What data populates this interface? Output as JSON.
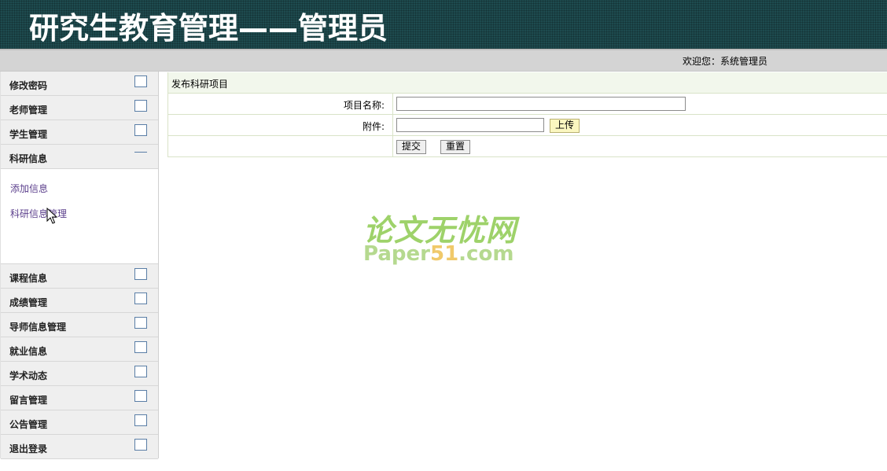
{
  "header": {
    "title": "研究生教育管理——管理员"
  },
  "welcome": {
    "text": "欢迎您：系统管理员"
  },
  "sidebar": {
    "items_top": [
      {
        "label": "修改密码"
      },
      {
        "label": "老师管理"
      },
      {
        "label": "学生管理"
      }
    ],
    "open_item": {
      "label": "科研信息",
      "sublinks": [
        {
          "label": "添加信息"
        },
        {
          "label": "科研信息管理"
        }
      ]
    },
    "items_bottom": [
      {
        "label": "课程信息"
      },
      {
        "label": "成绩管理"
      },
      {
        "label": "导师信息管理"
      },
      {
        "label": "就业信息"
      },
      {
        "label": "学术动态"
      },
      {
        "label": "留言管理"
      },
      {
        "label": "公告管理"
      },
      {
        "label": "退出登录"
      }
    ]
  },
  "form": {
    "title": "发布科研项目",
    "project_name_label": "项目名称:",
    "project_name_value": "",
    "attachment_label": "附件:",
    "attachment_value": "",
    "upload_label": "上传",
    "submit_label": "提交",
    "reset_label": "重置"
  },
  "watermark": {
    "cn": "论文无忧网",
    "en_pre": "Paper",
    "en_hl": "51",
    "en_post": ".com"
  },
  "colors": {
    "header_bg": "#1e4b4f",
    "welcome_bar_bg": "#d4d4d4",
    "sidebar_item_bg": "#efefef",
    "link_color": "#5b3f8c",
    "form_border": "#d9e3c8",
    "upload_bg": "#fbf7c0"
  }
}
